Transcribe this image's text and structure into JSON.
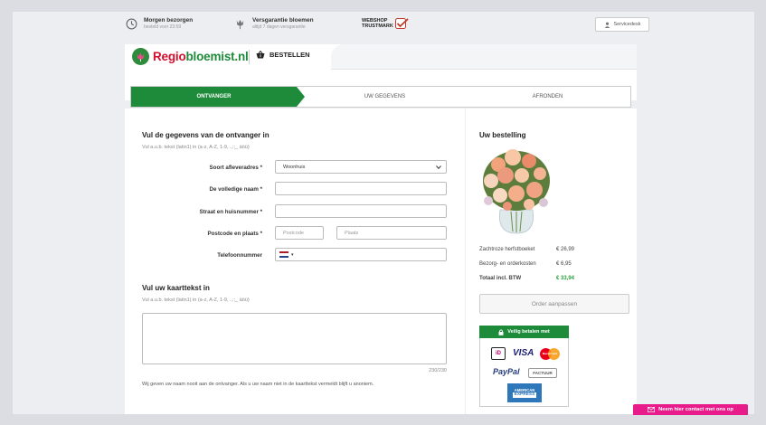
{
  "topbar": {
    "usp1": {
      "title": "Morgen bezorgen",
      "sub": "besteld voor 23:59",
      "icon": "clock-icon"
    },
    "usp2": {
      "title": "Versgarantie bloemen",
      "sub": "altijd 7 dagen versgarantie",
      "icon": "tulip-icon"
    },
    "trustmark": {
      "line1": "WEBSHOP",
      "line2": "TRUSTMARK"
    },
    "service_label": "Servicedesk"
  },
  "header": {
    "brand_part1": "Regio",
    "brand_part2": "bloemist.nl",
    "section": "BESTELLEN",
    "accent": "#1e8b3a",
    "brand_red": "#d40f2c"
  },
  "steps": [
    {
      "label": "ONTVANGER",
      "active": true
    },
    {
      "label": "UW GEGEVENS",
      "active": false
    },
    {
      "label": "AFRONDEN",
      "active": false
    }
  ],
  "form": {
    "title": "Vul de gegevens van de ontvanger in",
    "hint": "Vul a.u.b. tekst (latin1) in (a-z, A-Z, 1-9, .,:;_ äöü)",
    "fields": {
      "address_type_label": "Soort afleveradres *",
      "address_type_value": "Woonhuis",
      "name_label": "De volledige naam *",
      "street_label": "Straat en huisnummer *",
      "postal_label": "Postcode en plaats *",
      "postcode_placeholder": "Postcode",
      "city_placeholder": "Plaats",
      "phone_label": "Telefoonnummer",
      "phone_country": "▾"
    },
    "card_title": "Vul uw kaarttekst in",
    "card_hint": "Vul a.u.b. tekst (latin1) in (a-z, A-Z, 1-9, .,:;_ äöü)",
    "card_counter": "230/230",
    "note": "Wij geven uw naam nooit aan de ontvanger. Als u uw naam niet in de kaarttekst vermeldt blijft u anoniem."
  },
  "order": {
    "title": "Uw bestelling",
    "lines": [
      {
        "label": "Zachtroze herfstboeket",
        "value": "€ 26,99"
      },
      {
        "label": "Bezorg- en orderkosten",
        "value": "€ 6,95"
      },
      {
        "label": "Totaal incl. BTW",
        "value": "€ 33,94"
      }
    ],
    "edit_button": "Order aanpassen",
    "pay_title": "Veilig betalen met",
    "pay_methods": {
      "ideal": "iD",
      "visa": "VISA",
      "mastercard": "MasterCard",
      "paypal": "PayPal",
      "factuur": "FACTUUR",
      "amex1": "AMERICAN",
      "amex2": "EXPRESS"
    }
  },
  "contact_label": "Neem hier contact met ons op"
}
